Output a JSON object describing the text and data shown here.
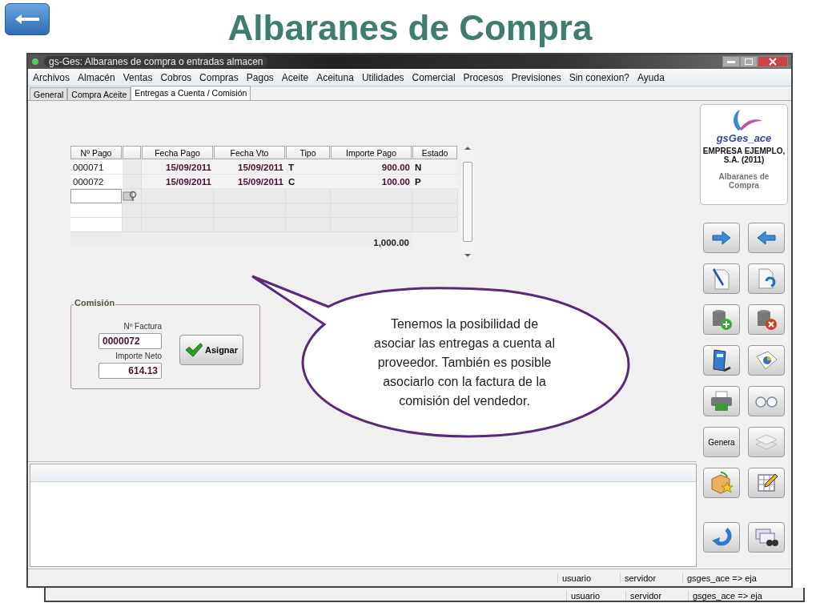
{
  "slide_title": "Albaranes de Compra",
  "window": {
    "title": "gs-Ges: Albaranes de compra o entradas almacen"
  },
  "menu": [
    "Archivos",
    "Almacén",
    "Ventas",
    "Cobros",
    "Compras",
    "Pagos",
    "Aceite",
    "Aceituna",
    "Utilidades",
    "Comercial",
    "Procesos",
    "Previsiones",
    "Sin conexion?",
    "Ayuda"
  ],
  "tabs": [
    {
      "label": "General",
      "selected": false
    },
    {
      "label": "Compra Aceite",
      "selected": false
    },
    {
      "label": "Entregas a Cuenta / Comisión",
      "selected": true
    }
  ],
  "payments_table": {
    "columns": [
      "Nº Pago",
      "Fecha Pago",
      "Fecha Vto",
      "Tipo",
      "Importe Pago",
      "Estado"
    ],
    "rows": [
      [
        "000071",
        "15/09/2011",
        "15/09/2011",
        "T",
        "900.00",
        "N"
      ],
      [
        "000072",
        "15/09/2011",
        "15/09/2011",
        "C",
        "100.00",
        "P"
      ]
    ],
    "total": "1,000.00"
  },
  "commission": {
    "legend": "Comisión",
    "invoice_label": "Nº Factura",
    "invoice_value": "0000072",
    "net_label": "Importe Neto",
    "net_value": "614.13",
    "button": "Asignar"
  },
  "company_card": {
    "logo_text": "gsGes_ace",
    "company": "EMPRESA EJEMPLO, S.A. (2011)",
    "module": "Albaranes de Compra"
  },
  "toolbar_buttons": [
    {
      "kind": "icon"
    },
    {
      "kind": "icon"
    },
    {
      "kind": "icon"
    },
    {
      "kind": "icon"
    },
    {
      "kind": "icon"
    },
    {
      "kind": "icon"
    },
    {
      "kind": "icon"
    },
    {
      "kind": "icon"
    },
    {
      "kind": "icon"
    },
    {
      "kind": "icon"
    },
    {
      "kind": "text",
      "label": "Genera"
    },
    {
      "kind": "icon"
    },
    {
      "kind": "icon"
    },
    {
      "kind": "icon"
    },
    {
      "kind": "icon"
    },
    {
      "kind": "icon"
    }
  ],
  "status_bar": [
    "usuario",
    "servidor",
    "gsges_ace => eja"
  ],
  "back_window_status_bar": [
    "usuario",
    "servidor",
    "gsges_ace => eja"
  ],
  "callout": "Tenemos la posibilidad de asociar las entregas a cuenta al proveedor. También es posible asociarlo con la factura de la comisión del vendedor."
}
